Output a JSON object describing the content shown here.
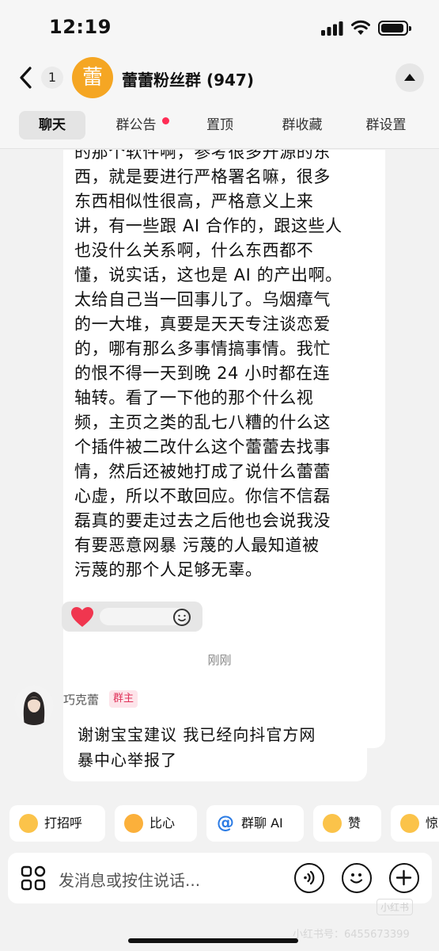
{
  "status_bar": {
    "time": "12:19"
  },
  "header": {
    "unread_count": "1",
    "avatar_text": "蕾",
    "title": "蕾蕾粉丝群 (947)"
  },
  "tabs": [
    {
      "label": "聊天",
      "active": true
    },
    {
      "label": "群公告",
      "has_dot": true
    },
    {
      "label": "置顶"
    },
    {
      "label": "群收藏"
    },
    {
      "label": "群设置"
    }
  ],
  "messages": {
    "long_message_lines": [
      "的那个软件啊，参考很多开源的东",
      "西，就是要进行严格署名嘛，很多",
      "东西相似性很高，严格意义上来",
      "讲，有一些跟 AI 合作的，跟这些人",
      "也没什么关系啊，什么东西都不",
      "懂，说实话，这也是 AI 的产出啊。",
      "太给自己当一回事儿了。乌烟瘴气",
      "的一大堆，真要是天天专注谈恋爱",
      "的，哪有那么多事情搞事情。我忙",
      "的恨不得一天到晚 24 小时都在连",
      "轴转。看了一下他的那个什么视",
      "频，主页之类的乱七八糟的什么这",
      "个插件被二改什么这个蕾蕾去找事",
      "情，然后还被她打成了说什么蕾蕾",
      "心虚，所以不敢回应。你信不信磊",
      "磊真的要走过去之后他也会说我没",
      "有要恶意网暴 污蔑的人最知道被",
      "污蔑的那个人足够无辜。"
    ],
    "timestamp": "刚刚",
    "reply": {
      "sender_name": "巧克蕾",
      "sender_badge": "群主",
      "lines": [
        "谢谢宝宝建议 我已经向抖官方网",
        "暴中心举报了"
      ]
    }
  },
  "quick_replies": [
    {
      "label": "打招呼",
      "icon": "wave-emoji-icon"
    },
    {
      "label": "比心",
      "icon": "heart-hands-emoji-icon"
    },
    {
      "label": "群聊 AI",
      "icon": "at-icon"
    },
    {
      "label": "赞",
      "icon": "thumbs-up-emoji-icon"
    },
    {
      "label": "惊",
      "icon": "surprised-emoji-icon"
    }
  ],
  "input": {
    "placeholder": "发消息或按住说话..."
  },
  "watermark": {
    "logo": "小红书",
    "text": "小红书号：6455673399"
  },
  "colors": {
    "accent": "#f5a623",
    "badge_red": "#ff2d55",
    "owner_badge": "#e0335a"
  }
}
